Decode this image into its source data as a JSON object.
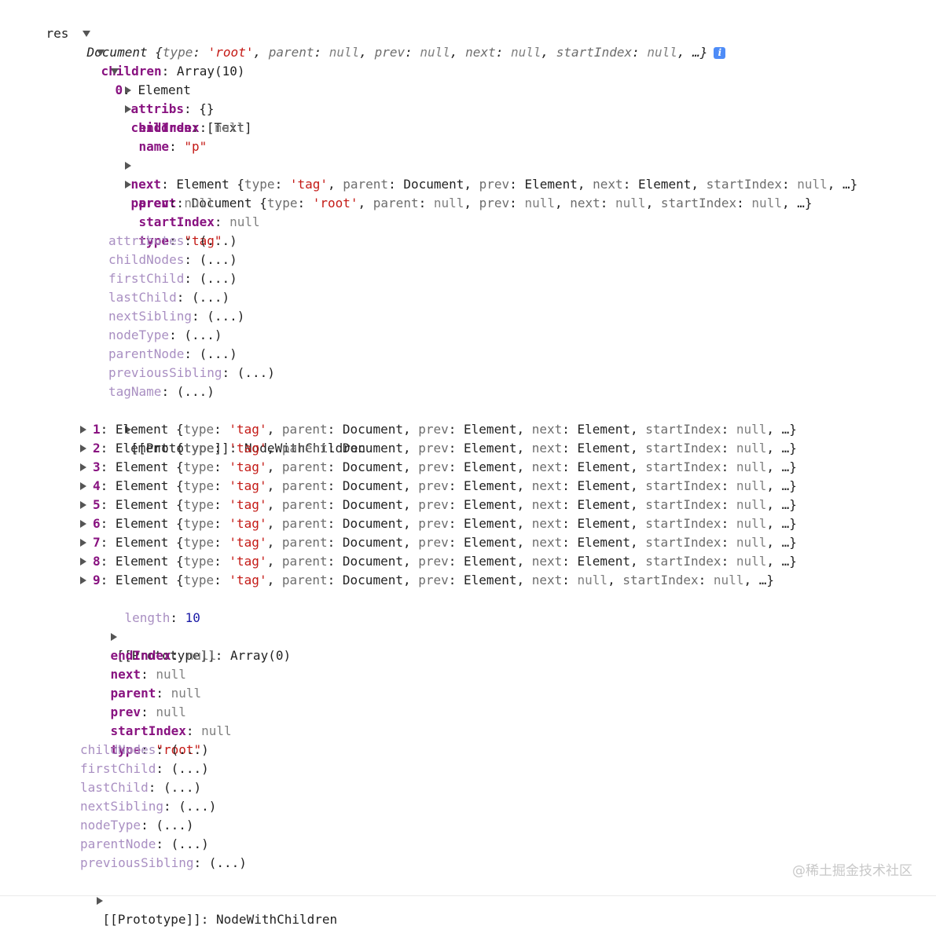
{
  "var_label": "res",
  "doc_summary": {
    "name": "Document",
    "open": " {",
    "type_key": "type",
    "type_value": "'root'",
    "parent_key": "parent",
    "prev_key": "prev",
    "next_key": "next",
    "startIndex_key": "startIndex",
    "null": "null",
    "close": ", …}"
  },
  "children": {
    "key": "children",
    "summary": "Array(10)",
    "item0": {
      "index": "0",
      "value": "Element",
      "attribs": {
        "key": "attribs",
        "value": "{}"
      },
      "children": {
        "key": "children",
        "value": "[Text]"
      },
      "endIndex": {
        "key": "endIndex",
        "value": "null"
      },
      "name": {
        "key": "name",
        "value": "\"p\""
      },
      "next": {
        "key": "next",
        "name": "Element",
        "type_value": "'tag'",
        "parent_value": "Document",
        "prev_value": "Element",
        "next_value": "Element",
        "startIndex_value": "null"
      },
      "parent": {
        "key": "parent",
        "name": "Document",
        "type_value": "'root'",
        "parent_value": "null",
        "prev_value": "null",
        "next_value": "null",
        "startIndex_value": "null"
      },
      "prev": {
        "key": "prev",
        "value": "null"
      },
      "startIndex": {
        "key": "startIndex",
        "value": "null"
      },
      "type": {
        "key": "type",
        "value": "\"tag\""
      },
      "getters": [
        "attributes",
        "childNodes",
        "firstChild",
        "lastChild",
        "nextSibling",
        "nodeType",
        "parentNode",
        "previousSibling",
        "tagName"
      ],
      "getter_value": "(...)",
      "prototype": {
        "key": "[[Prototype]]",
        "value": "NodeWithChildren"
      }
    },
    "items": [
      {
        "index": "1",
        "next_value": "Element"
      },
      {
        "index": "2",
        "next_value": "Element"
      },
      {
        "index": "3",
        "next_value": "Element"
      },
      {
        "index": "4",
        "next_value": "Element"
      },
      {
        "index": "5",
        "next_value": "Element"
      },
      {
        "index": "6",
        "next_value": "Element"
      },
      {
        "index": "7",
        "next_value": "Element"
      },
      {
        "index": "8",
        "next_value": "Element"
      },
      {
        "index": "9",
        "next_value": "null"
      }
    ],
    "item_common": {
      "name": "Element",
      "type_value": "'tag'",
      "parent_value": "Document",
      "prev_value": "Element",
      "startIndex_value": "null"
    },
    "length": {
      "key": "length",
      "value": "10"
    },
    "prototype": {
      "key": "[[Prototype]]",
      "value": "Array(0)"
    }
  },
  "doc_props": {
    "endIndex": {
      "key": "endIndex",
      "value": "null"
    },
    "next": {
      "key": "next",
      "value": "null"
    },
    "parent": {
      "key": "parent",
      "value": "null"
    },
    "prev": {
      "key": "prev",
      "value": "null"
    },
    "startIndex": {
      "key": "startIndex",
      "value": "null"
    },
    "type": {
      "key": "type",
      "value": "\"root\""
    },
    "getters": [
      "childNodes",
      "firstChild",
      "lastChild",
      "nextSibling",
      "nodeType",
      "parentNode",
      "previousSibling"
    ],
    "getter_value": "(...)",
    "prototype": {
      "key": "[[Prototype]]",
      "value": "NodeWithChildren"
    }
  },
  "watermark": "@稀土掘金技术社区",
  "colors": {
    "key": "#881280",
    "dim_key": "#a98fc2",
    "string": "#c41a16",
    "number": "#1a1aa6",
    "null": "#808080",
    "info_icon": "#4e8cf7"
  }
}
